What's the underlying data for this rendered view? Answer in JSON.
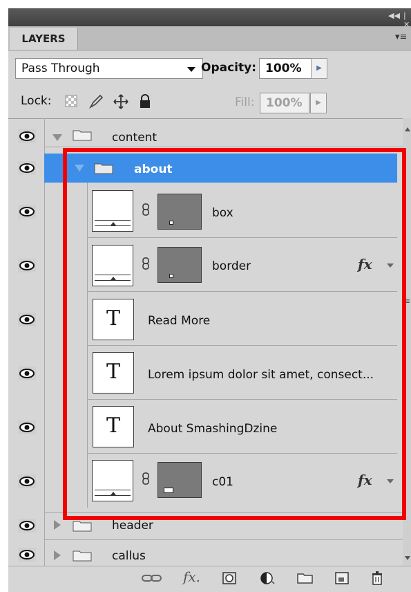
{
  "panel": {
    "tab_label": "LAYERS",
    "blend_mode": "Pass Through",
    "opacity_label": "Opacity:",
    "opacity_value": "100%",
    "lock_label": "Lock:",
    "fill_label": "Fill:",
    "fill_value": "100%"
  },
  "layers": [
    {
      "name": "content",
      "kind": "group",
      "expanded": true
    },
    {
      "name": "about",
      "kind": "group",
      "expanded": true,
      "selected": true
    },
    {
      "name": "box",
      "kind": "shape"
    },
    {
      "name": "border",
      "kind": "shape",
      "fx": "fx"
    },
    {
      "name": "Read More",
      "kind": "text"
    },
    {
      "name": "Lorem ipsum dolor sit amet, consect...",
      "kind": "text"
    },
    {
      "name": "About SmashingDzine",
      "kind": "text"
    },
    {
      "name": "c01",
      "kind": "shape",
      "fx": "fx"
    },
    {
      "name": "header",
      "kind": "group",
      "expanded": false
    },
    {
      "name": "callus",
      "kind": "group",
      "expanded": false
    }
  ],
  "thumb_letter": "T",
  "colors": {
    "panel_bg": "#d6d6d6",
    "selection": "#3d8ee8",
    "highlight_box": "#f20000"
  },
  "icons": {
    "visibility": "eye-icon",
    "group": "folder-icon",
    "link": "chain-link-icon",
    "bottom": [
      "link-layers-icon",
      "fx-icon",
      "layer-mask-icon",
      "adjustment-layer-icon",
      "new-group-icon",
      "new-layer-icon",
      "trash-icon"
    ]
  }
}
